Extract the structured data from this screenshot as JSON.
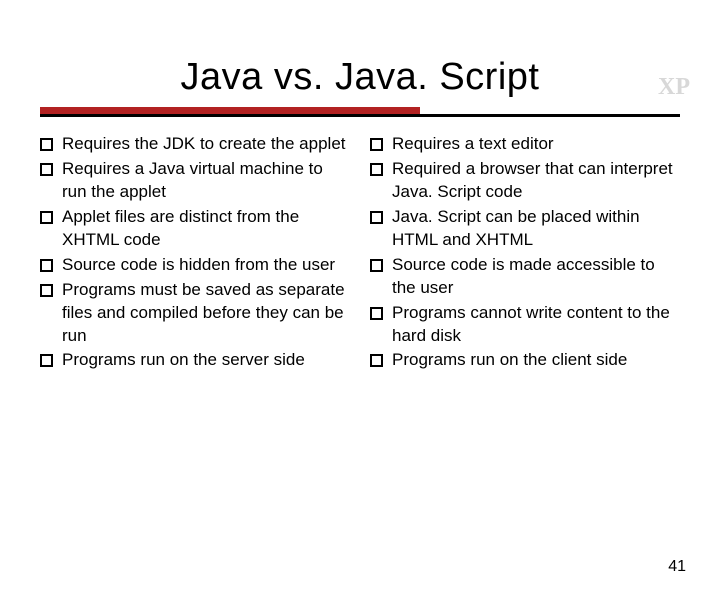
{
  "corner_label": "XP",
  "title": "Java vs. Java. Script",
  "columns": {
    "left": [
      "Requires the JDK to create the applet",
      "Requires a Java virtual machine to run the applet",
      "Applet files are distinct from the XHTML code",
      "Source code is hidden from the user",
      "Programs must be saved as separate files and compiled before they can be run",
      "Programs run on the server side"
    ],
    "right": [
      "Requires a text editor",
      "Required a browser that can interpret Java. Script code",
      "Java. Script can be placed within HTML and XHTML",
      "Source code is made accessible to the user",
      "Programs cannot write content to the hard disk",
      "Programs run on the client side"
    ]
  },
  "page_number": "41"
}
